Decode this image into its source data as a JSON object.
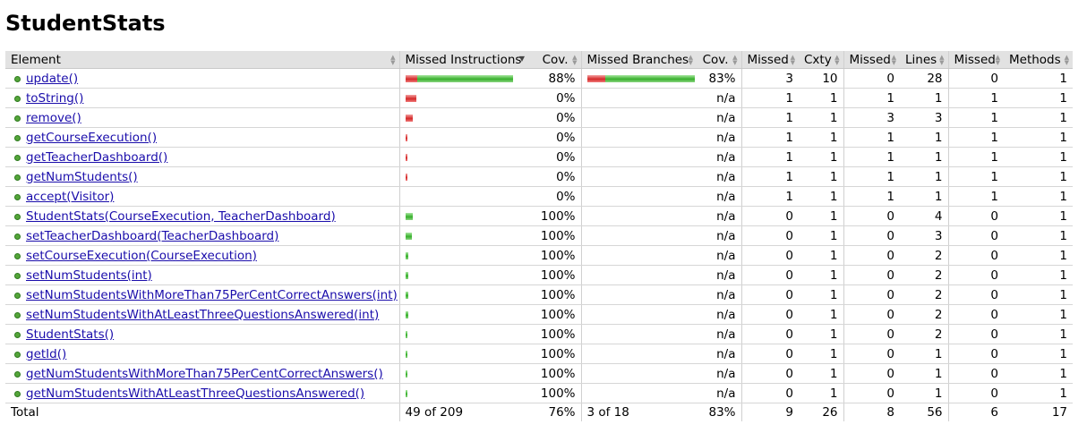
{
  "page": {
    "title": "StudentStats"
  },
  "table": {
    "headers": {
      "element": "Element",
      "missed_instructions": "Missed Instructions",
      "cov1": "Cov.",
      "missed_branches": "Missed Branches",
      "cov2": "Cov.",
      "missed_cxty": "Missed",
      "cxty": "Cxty",
      "missed_lines": "Missed",
      "lines": "Lines",
      "missed_methods": "Missed",
      "methods": "Methods"
    },
    "rows": [
      {
        "name": "update()",
        "instr_missed_frac": 0.11,
        "instr_covered_frac": 0.89,
        "instr_cov": "88%",
        "branch_missed_frac": 0.17,
        "branch_covered_frac": 0.83,
        "branch_cov": "83%",
        "missed_cxty": "3",
        "cxty": "10",
        "missed_lines": "0",
        "lines": "28",
        "missed_methods": "0",
        "methods": "1"
      },
      {
        "name": "toString()",
        "instr_missed_frac": 0.1,
        "instr_covered_frac": 0,
        "instr_cov": "0%",
        "branch_missed_frac": 0,
        "branch_covered_frac": 0,
        "branch_cov": "n/a",
        "missed_cxty": "1",
        "cxty": "1",
        "missed_lines": "1",
        "lines": "1",
        "missed_methods": "1",
        "methods": "1"
      },
      {
        "name": "remove()",
        "instr_missed_frac": 0.07,
        "instr_covered_frac": 0,
        "instr_cov": "0%",
        "branch_missed_frac": 0,
        "branch_covered_frac": 0,
        "branch_cov": "n/a",
        "missed_cxty": "1",
        "cxty": "1",
        "missed_lines": "3",
        "lines": "3",
        "missed_methods": "1",
        "methods": "1"
      },
      {
        "name": "getCourseExecution()",
        "instr_missed_frac": 0.015,
        "instr_covered_frac": 0,
        "instr_cov": "0%",
        "branch_missed_frac": 0,
        "branch_covered_frac": 0,
        "branch_cov": "n/a",
        "missed_cxty": "1",
        "cxty": "1",
        "missed_lines": "1",
        "lines": "1",
        "missed_methods": "1",
        "methods": "1"
      },
      {
        "name": "getTeacherDashboard()",
        "instr_missed_frac": 0.015,
        "instr_covered_frac": 0,
        "instr_cov": "0%",
        "branch_missed_frac": 0,
        "branch_covered_frac": 0,
        "branch_cov": "n/a",
        "missed_cxty": "1",
        "cxty": "1",
        "missed_lines": "1",
        "lines": "1",
        "missed_methods": "1",
        "methods": "1"
      },
      {
        "name": "getNumStudents()",
        "instr_missed_frac": 0.015,
        "instr_covered_frac": 0,
        "instr_cov": "0%",
        "branch_missed_frac": 0,
        "branch_covered_frac": 0,
        "branch_cov": "n/a",
        "missed_cxty": "1",
        "cxty": "1",
        "missed_lines": "1",
        "lines": "1",
        "missed_methods": "1",
        "methods": "1"
      },
      {
        "name": "accept(Visitor)",
        "instr_missed_frac": 0,
        "instr_covered_frac": 0,
        "instr_cov": "0%",
        "branch_missed_frac": 0,
        "branch_covered_frac": 0,
        "branch_cov": "n/a",
        "missed_cxty": "1",
        "cxty": "1",
        "missed_lines": "1",
        "lines": "1",
        "missed_methods": "1",
        "methods": "1"
      },
      {
        "name": "StudentStats(CourseExecution, TeacherDashboard)",
        "instr_missed_frac": 0,
        "instr_covered_frac": 0.065,
        "instr_cov": "100%",
        "branch_missed_frac": 0,
        "branch_covered_frac": 0,
        "branch_cov": "n/a",
        "missed_cxty": "0",
        "cxty": "1",
        "missed_lines": "0",
        "lines": "4",
        "missed_methods": "0",
        "methods": "1"
      },
      {
        "name": "setTeacherDashboard(TeacherDashboard)",
        "instr_missed_frac": 0,
        "instr_covered_frac": 0.055,
        "instr_cov": "100%",
        "branch_missed_frac": 0,
        "branch_covered_frac": 0,
        "branch_cov": "n/a",
        "missed_cxty": "0",
        "cxty": "1",
        "missed_lines": "0",
        "lines": "3",
        "missed_methods": "0",
        "methods": "1"
      },
      {
        "name": "setCourseExecution(CourseExecution)",
        "instr_missed_frac": 0,
        "instr_covered_frac": 0.025,
        "instr_cov": "100%",
        "branch_missed_frac": 0,
        "branch_covered_frac": 0,
        "branch_cov": "n/a",
        "missed_cxty": "0",
        "cxty": "1",
        "missed_lines": "0",
        "lines": "2",
        "missed_methods": "0",
        "methods": "1"
      },
      {
        "name": "setNumStudents(int)",
        "instr_missed_frac": 0,
        "instr_covered_frac": 0.025,
        "instr_cov": "100%",
        "branch_missed_frac": 0,
        "branch_covered_frac": 0,
        "branch_cov": "n/a",
        "missed_cxty": "0",
        "cxty": "1",
        "missed_lines": "0",
        "lines": "2",
        "missed_methods": "0",
        "methods": "1"
      },
      {
        "name": "setNumStudentsWithMoreThan75PerCentCorrectAnswers(int)",
        "instr_missed_frac": 0,
        "instr_covered_frac": 0.025,
        "instr_cov": "100%",
        "branch_missed_frac": 0,
        "branch_covered_frac": 0,
        "branch_cov": "n/a",
        "missed_cxty": "0",
        "cxty": "1",
        "missed_lines": "0",
        "lines": "2",
        "missed_methods": "0",
        "methods": "1"
      },
      {
        "name": "setNumStudentsWithAtLeastThreeQuestionsAnswered(int)",
        "instr_missed_frac": 0,
        "instr_covered_frac": 0.025,
        "instr_cov": "100%",
        "branch_missed_frac": 0,
        "branch_covered_frac": 0,
        "branch_cov": "n/a",
        "missed_cxty": "0",
        "cxty": "1",
        "missed_lines": "0",
        "lines": "2",
        "missed_methods": "0",
        "methods": "1"
      },
      {
        "name": "StudentStats()",
        "instr_missed_frac": 0,
        "instr_covered_frac": 0.015,
        "instr_cov": "100%",
        "branch_missed_frac": 0,
        "branch_covered_frac": 0,
        "branch_cov": "n/a",
        "missed_cxty": "0",
        "cxty": "1",
        "missed_lines": "0",
        "lines": "2",
        "missed_methods": "0",
        "methods": "1"
      },
      {
        "name": "getId()",
        "instr_missed_frac": 0,
        "instr_covered_frac": 0.015,
        "instr_cov": "100%",
        "branch_missed_frac": 0,
        "branch_covered_frac": 0,
        "branch_cov": "n/a",
        "missed_cxty": "0",
        "cxty": "1",
        "missed_lines": "0",
        "lines": "1",
        "missed_methods": "0",
        "methods": "1"
      },
      {
        "name": "getNumStudentsWithMoreThan75PerCentCorrectAnswers()",
        "instr_missed_frac": 0,
        "instr_covered_frac": 0.015,
        "instr_cov": "100%",
        "branch_missed_frac": 0,
        "branch_covered_frac": 0,
        "branch_cov": "n/a",
        "missed_cxty": "0",
        "cxty": "1",
        "missed_lines": "0",
        "lines": "1",
        "missed_methods": "0",
        "methods": "1"
      },
      {
        "name": "getNumStudentsWithAtLeastThreeQuestionsAnswered()",
        "instr_missed_frac": 0,
        "instr_covered_frac": 0.015,
        "instr_cov": "100%",
        "branch_missed_frac": 0,
        "branch_covered_frac": 0,
        "branch_cov": "n/a",
        "missed_cxty": "0",
        "cxty": "1",
        "missed_lines": "0",
        "lines": "1",
        "missed_methods": "0",
        "methods": "1"
      }
    ],
    "total": {
      "label": "Total",
      "instructions": "49 of 209",
      "instr_cov": "76%",
      "branches": "3 of 18",
      "branch_cov": "83%",
      "missed_cxty": "9",
      "cxty": "26",
      "missed_lines": "8",
      "lines": "56",
      "missed_methods": "6",
      "methods": "17"
    }
  },
  "colors": {
    "header_bg": "#e2e2e2",
    "link": "#1a0dab",
    "bar_missed": "#d42a2a",
    "bar_covered": "#38b02c"
  }
}
